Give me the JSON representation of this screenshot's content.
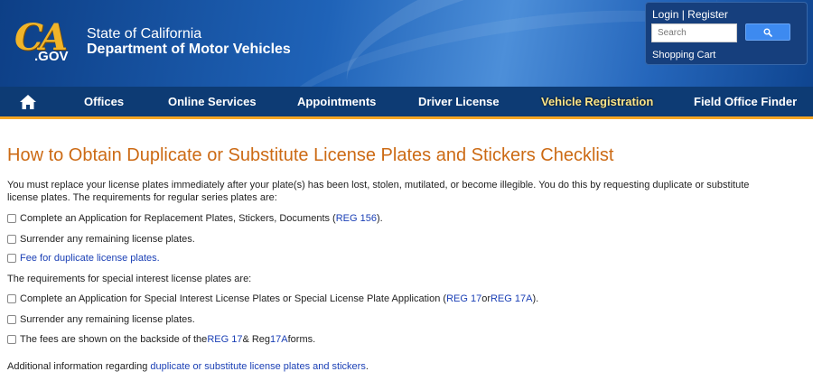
{
  "header": {
    "logo_main": "CA",
    "logo_gov": ".GOV",
    "state_line": "State of California",
    "dept_line": "Department of Motor Vehicles"
  },
  "account": {
    "login": "Login",
    "separator": " | ",
    "register": "Register",
    "search_placeholder": "Search",
    "search_icon": "magnifier-icon",
    "cart": "Shopping Cart"
  },
  "nav": {
    "home_icon": "home-icon",
    "items": [
      {
        "label": "Offices"
      },
      {
        "label": "Online Services"
      },
      {
        "label": "Appointments"
      },
      {
        "label": "Driver License"
      },
      {
        "label": "Vehicle Registration",
        "active": true
      },
      {
        "label": "Field Office Finder"
      }
    ]
  },
  "colors": {
    "title": "#cc6a14",
    "link": "#1a3fb5",
    "nav_bg": "#0d3b74",
    "nav_accent": "#f5a623",
    "active_nav": "#fde68a"
  },
  "main": {
    "title": "How to Obtain Duplicate or Substitute License Plates and Stickers Checklist",
    "intro": "You must replace your license plates immediately after your plate(s) has been lost, stolen, mutilated, or become illegible. You do this by requesting duplicate or substitute license plates. The requirements for regular series plates are:",
    "regular": {
      "item1_pre": "Complete an Application for Replacement Plates, Stickers, Documents (",
      "item1_link": "REG 156",
      "item1_post": ").",
      "item2": "Surrender any remaining license plates.",
      "item3_link": "Fee for duplicate license plates."
    },
    "special_heading": "The requirements for special interest license plates are:",
    "special": {
      "item1_pre": "Complete an Application for Special Interest License Plates or Special License Plate Application (",
      "item1_link1": "REG 17",
      "item1_mid": " or ",
      "item1_link2": "REG 17A",
      "item1_post": ").",
      "item2": "Surrender any remaining license plates.",
      "item3_pre": "The fees are shown on the backside of the ",
      "item3_link1": "REG 17",
      "item3_mid": " & Reg ",
      "item3_link2": "17A",
      "item3_post": " forms."
    },
    "additional_pre": "Additional information regarding ",
    "additional_link": "duplicate or substitute license plates and stickers",
    "additional_post": "."
  }
}
